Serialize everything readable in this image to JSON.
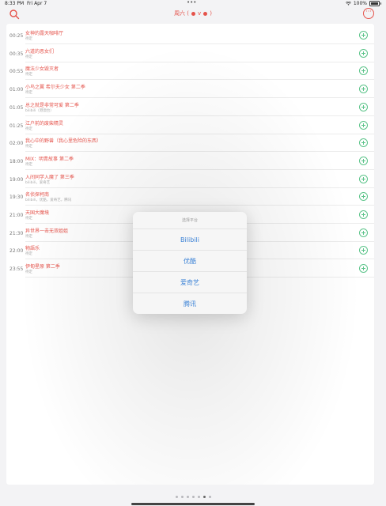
{
  "status": {
    "time": "8:33 PM",
    "date": "Fri Apr 7",
    "dots": "•••",
    "battery": "100%"
  },
  "nav": {
    "title_left": "周六 (",
    "title_arrow": "v",
    "title_right": ")"
  },
  "schedule": [
    {
      "time": "00:25",
      "title": "女神的露天咖啡厅",
      "sub": "待定"
    },
    {
      "time": "00:35",
      "title": "六道的恶女们",
      "sub": "待定"
    },
    {
      "time": "00:55",
      "title": "魔法少女毁灭者",
      "sub": "待定"
    },
    {
      "time": "01:00",
      "title": "小鸟之翼 希尔夫少女 第二季",
      "sub": "待定"
    },
    {
      "time": "01:05",
      "title": "总之就是非常可爱 第二季",
      "sub": "bilibili（港澳台）"
    },
    {
      "time": "01:25",
      "title": "江户前的废柴精灵",
      "sub": "待定"
    },
    {
      "time": "02:00",
      "title": "我心中的野兽（我心里危险的东西）",
      "sub": "待定"
    },
    {
      "time": "18:00",
      "title": "MIX：明青故事 第二季",
      "sub": "待定"
    },
    {
      "time": "19:00",
      "title": "入间同学入魔了 第三季",
      "sub": "bilibili，爱奇艺"
    },
    {
      "time": "19:30",
      "title": "名侦探柯南",
      "sub": "bilibili，优酷，爱奇艺，腾讯"
    },
    {
      "time": "21:00",
      "title": "天国大魔境",
      "sub": "待定"
    },
    {
      "time": "21:30",
      "title": "异世界一击无双姐姐",
      "sub": "待定"
    },
    {
      "time": "22:00",
      "title": "物語乐",
      "sub": "待定"
    },
    {
      "time": "23:55",
      "title": "伊甸星原 第二季",
      "sub": "待定"
    }
  ],
  "popover": {
    "title": "选择平台",
    "options": [
      "Bilibili",
      "优酷",
      "爱奇艺",
      "腾讯"
    ]
  },
  "colors": {
    "accent": "#e5534b",
    "add_green": "#5cc48a",
    "option_blue": "#3b82d6"
  },
  "icons": {
    "search": "search-icon",
    "more": "more-icon",
    "add": "add-icon",
    "wifi": "wifi-icon",
    "battery": "battery-icon"
  },
  "page_dots": {
    "count": 7,
    "active_index": 5
  }
}
